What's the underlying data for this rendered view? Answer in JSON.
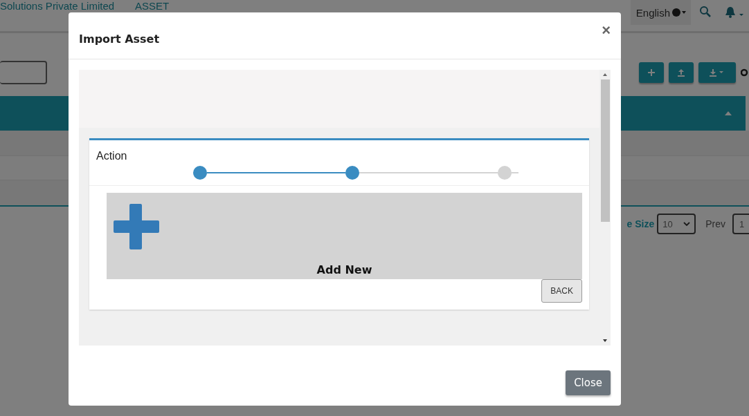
{
  "background": {
    "company": "Solutions Private Limited",
    "module": "ASSET",
    "language": "English",
    "pagination": {
      "page_size_label": "e Size",
      "page_size": "10",
      "prev": "Prev",
      "page": "1"
    }
  },
  "modal": {
    "title": "Import Asset",
    "close_symbol": "×",
    "section_title": "Action",
    "steps": [
      {
        "completed": true
      },
      {
        "completed": true
      },
      {
        "completed": false
      }
    ],
    "add_label": "Add New",
    "back": "BACK",
    "close": "Close"
  }
}
